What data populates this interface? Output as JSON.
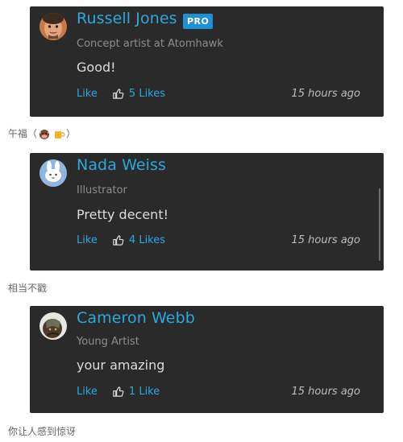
{
  "comments": [
    {
      "name": "Russell Jones",
      "badge": "PRO",
      "title": "Concept artist at Atomhawk",
      "text": "Good!",
      "like_label": "Like",
      "likes_count": "5 Likes",
      "time": "15 hours ago"
    },
    {
      "name": "Nada Weiss",
      "title": "Illustrator",
      "text": "Pretty decent!",
      "like_label": "Like",
      "likes_count": "4 Likes",
      "time": "15 hours ago"
    },
    {
      "name": "Cameron Webb",
      "title": "Young Artist",
      "text": "your amazing",
      "like_label": "Like",
      "likes_count": "1 Like",
      "time": "15 hours ago"
    }
  ],
  "captions": {
    "c1_prefix": "午福（",
    "c1_suffix": "）",
    "c1_emoji": [
      "cow-face-emoji",
      "beer-mug-emoji"
    ],
    "c2": "相当不戳",
    "c3": "你让人感到惊讶"
  },
  "colors": {
    "card_bg": "#2a2a2a",
    "name_blue": "#29a9df",
    "badge_blue": "#1f8fd6",
    "title_gray": "#8d8d8d",
    "text_light": "#dcdcdc"
  }
}
